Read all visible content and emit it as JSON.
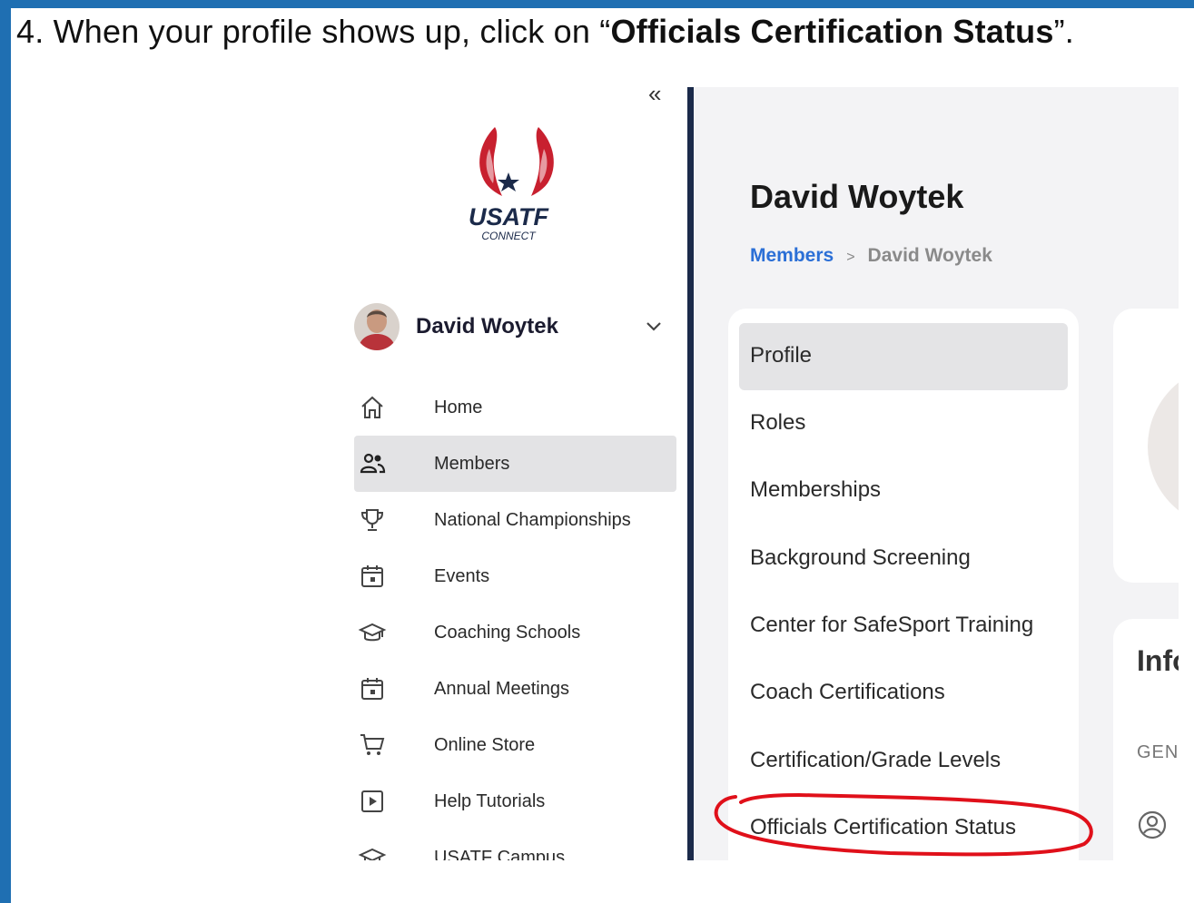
{
  "instruction": {
    "prefix": "4.  When your profile shows up, click on “",
    "highlight": "Officials Certification Status",
    "suffix": "”."
  },
  "sidebar": {
    "collapse_label": "«",
    "logo": {
      "line1": "USATF",
      "line2": "CONNECT"
    },
    "user": {
      "name": "David Woytek"
    },
    "items": [
      {
        "label": "Home",
        "icon": "home-icon"
      },
      {
        "label": "Members",
        "icon": "members-icon",
        "active": true
      },
      {
        "label": "National Championships",
        "icon": "trophy-icon"
      },
      {
        "label": "Events",
        "icon": "calendar-icon"
      },
      {
        "label": "Coaching Schools",
        "icon": "graduation-cap-icon"
      },
      {
        "label": "Annual Meetings",
        "icon": "calendar-icon"
      },
      {
        "label": "Online Store",
        "icon": "cart-icon"
      },
      {
        "label": "Help Tutorials",
        "icon": "play-icon"
      },
      {
        "label": "USATF Campus",
        "icon": "graduation-cap-icon"
      }
    ]
  },
  "main": {
    "title": "David Woytek",
    "breadcrumb": {
      "link": "Members",
      "separator": ">",
      "current": "David Woytek"
    },
    "menu": [
      {
        "label": "Profile",
        "active": true
      },
      {
        "label": "Roles"
      },
      {
        "label": "Memberships"
      },
      {
        "label": "Background Screening"
      },
      {
        "label": "Center for SafeSport Training"
      },
      {
        "label": "Coach Certifications"
      },
      {
        "label": "Certification/Grade Levels"
      },
      {
        "label": "Officials Certification Status"
      }
    ],
    "right_panel": {
      "heading": "Info",
      "sub": "GEN"
    }
  },
  "colors": {
    "frame": "#1f6fb2",
    "accent_link": "#2b6fd6",
    "logo_red": "#c8202f",
    "logo_navy": "#1b2a4a",
    "annotation_red": "#e0101a"
  }
}
